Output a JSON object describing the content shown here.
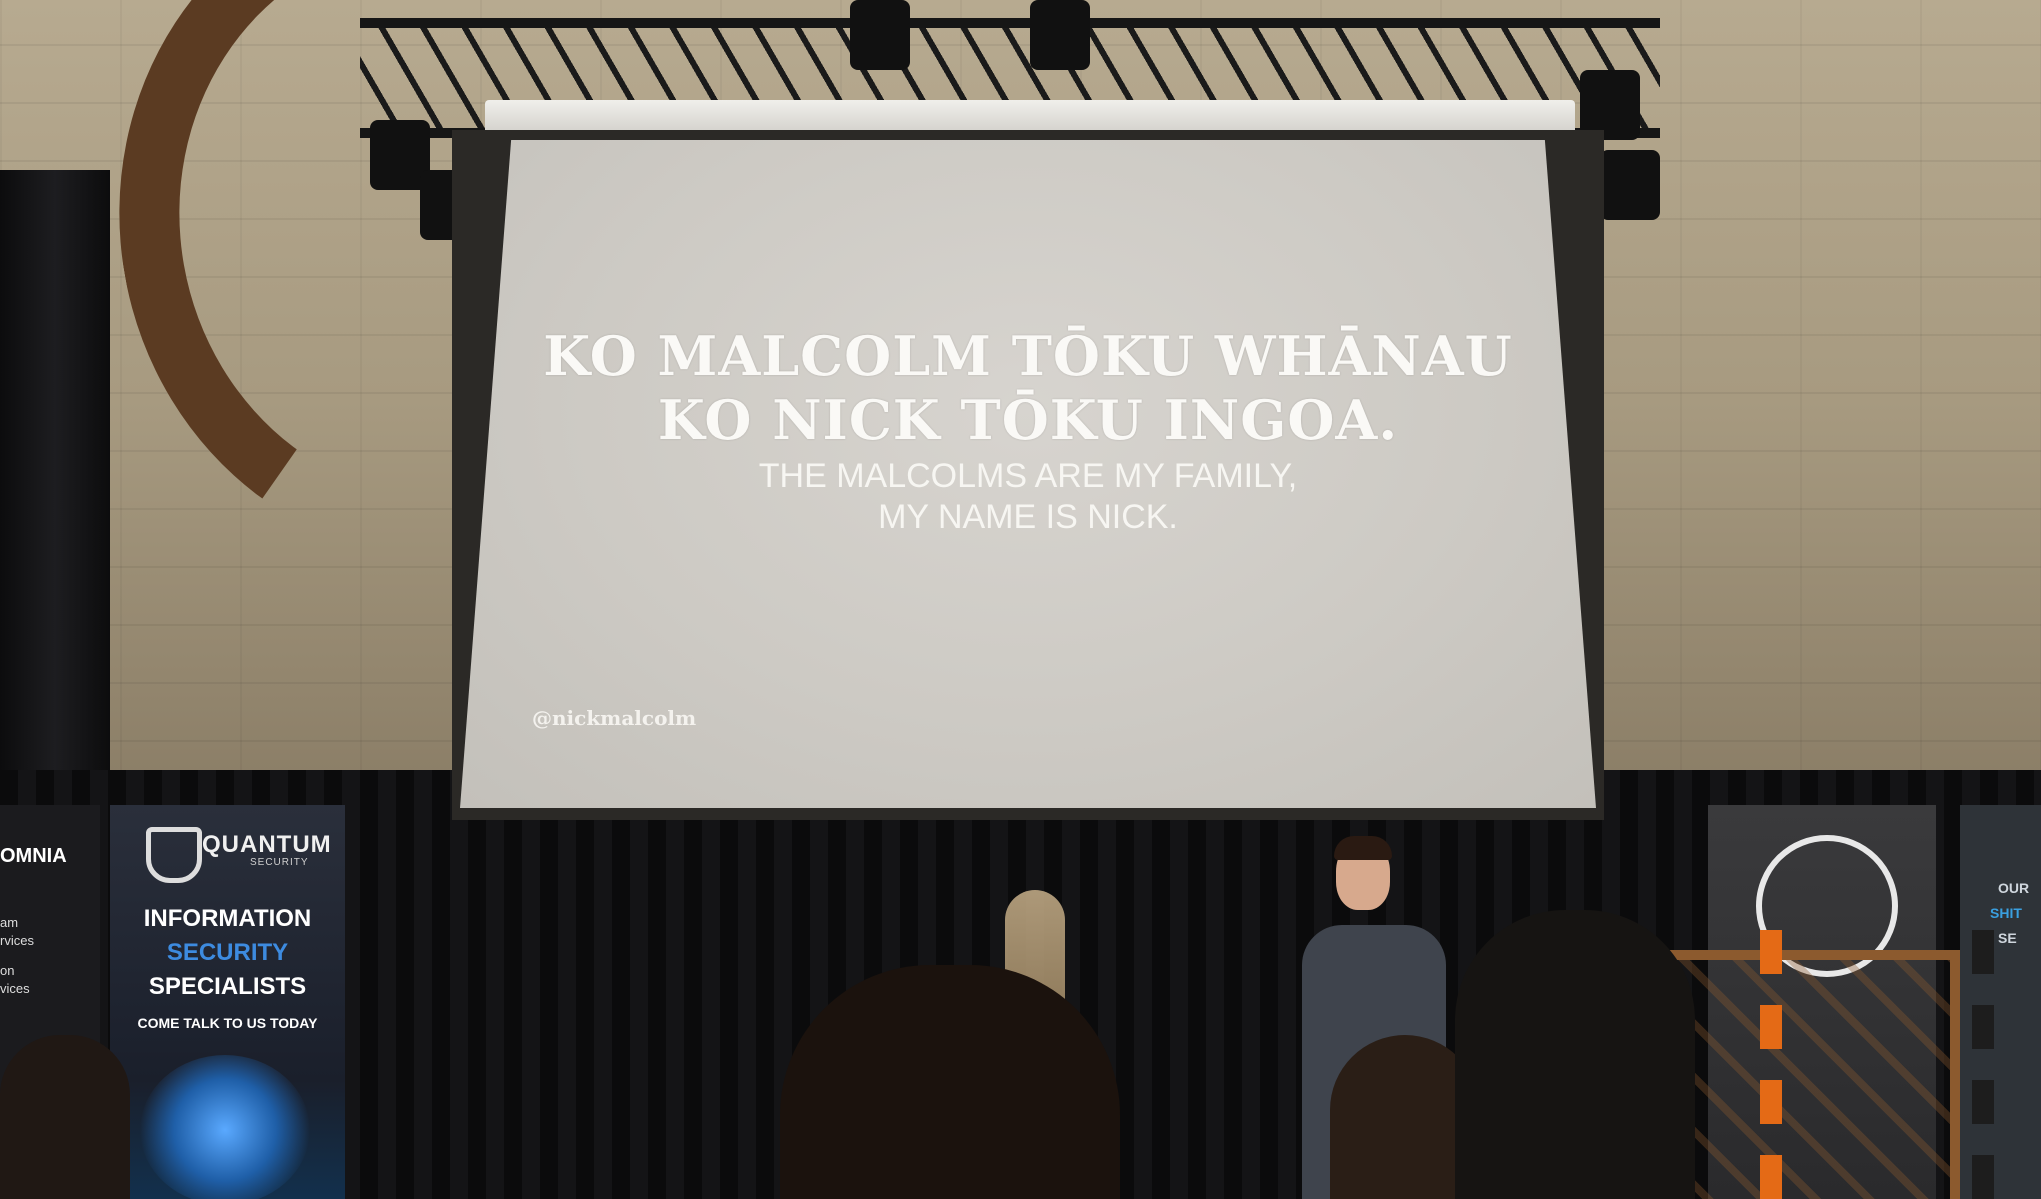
{
  "slide": {
    "title_lines": [
      "KO MALCOLM TŌKU WHĀNAU",
      "KO NICK TŌKU INGOA."
    ],
    "subtitle_lines": [
      "THE MALCOLMS ARE MY FAMILY,",
      "MY NAME IS NICK."
    ],
    "handle": "@nickmalcolm"
  },
  "banners": {
    "quantum": {
      "logo": "QUANTUM",
      "logo_sub": "SECURITY",
      "lines": [
        "INFORMATION",
        "SECURITY",
        "SPECIALISTS",
        "COME TALK TO US TODAY"
      ],
      "accent_color": "#3d8be0",
      "icon": "shield-icon"
    },
    "omnia": {
      "title": "OMNIA",
      "lines": [
        "am",
        "rvices",
        "on",
        "vices"
      ]
    },
    "right": {
      "icon": "beetle-icon",
      "lines": [
        "OUR",
        "SHIT",
        "SE"
      ]
    }
  }
}
